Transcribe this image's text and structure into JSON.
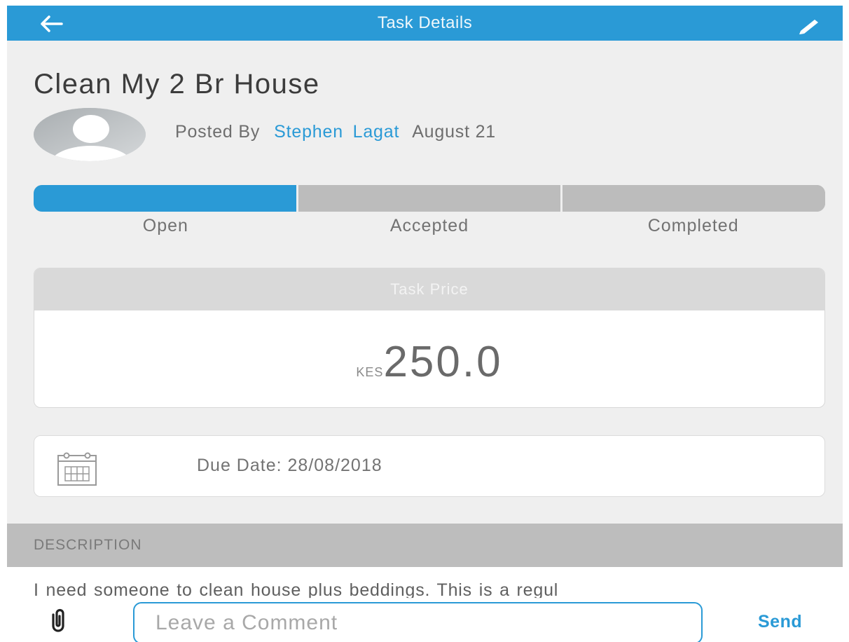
{
  "header": {
    "title": "Task Details",
    "back_icon": "arrow-left-icon",
    "edit_icon": "pencil-icon"
  },
  "task": {
    "title": "Clean My 2 Br House",
    "posted_by_label": "Posted By",
    "author": "Stephen Lagat",
    "date": "August 21"
  },
  "progress": {
    "stages": [
      "Open",
      "Accepted",
      "Completed"
    ],
    "current_stage_index": 0
  },
  "price": {
    "header": "Task Price",
    "currency": "KES",
    "amount": "250.0"
  },
  "due": {
    "icon": "calendar-icon",
    "text": "Due Date: 28/08/2018"
  },
  "description": {
    "header": "DESCRIPTION",
    "text": "I need someone to clean house plus beddings.  This is a regul"
  },
  "comment": {
    "attach_icon": "paperclip-icon",
    "placeholder": "Leave a Comment",
    "send_label": "Send"
  },
  "colors": {
    "primary": "#2a9ad6",
    "progress_inactive": "#bcbcbc",
    "background": "#efefef"
  }
}
